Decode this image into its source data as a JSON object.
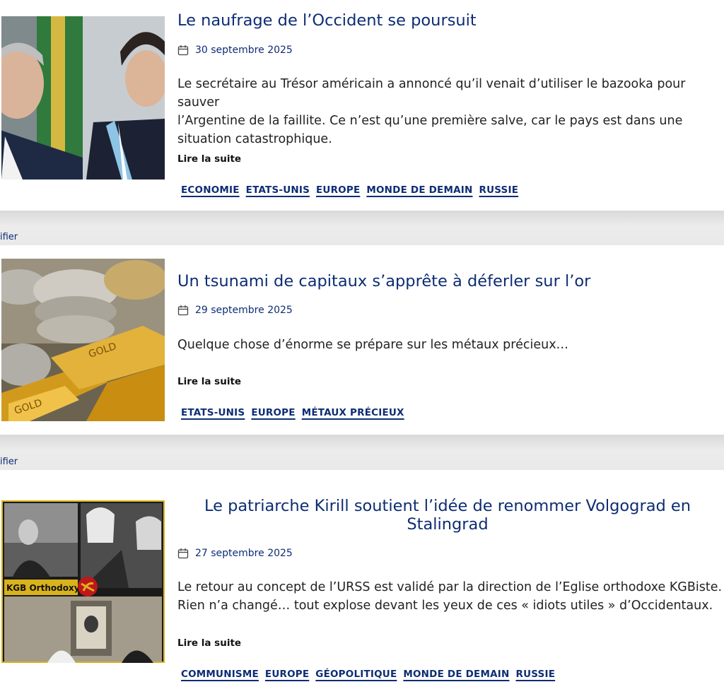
{
  "articles": [
    {
      "title": "Le naufrage de l’Occident se poursuit",
      "date": "30 septembre 2025",
      "excerpt_lines": [
        "Le secrétaire au Trésor américain a annoncé qu’il venait d’utiliser le bazooka pour sauver",
        "l’Argentine de la faillite. Ce n’est qu’une première salve, car le pays est dans une",
        "situation catastrophique."
      ],
      "read_more": "Lire la suite",
      "tags": [
        "ECONOMIE",
        "ETATS-UNIS",
        "EUROPE",
        "MONDE DE DEMAIN",
        "RUSSIE"
      ]
    },
    {
      "title": "Un tsunami de capitaux s’apprête à déferler sur l’or",
      "date": "29 septembre 2025",
      "excerpt_lines": [
        "Quelque chose d’énorme se prépare sur les métaux précieux…"
      ],
      "read_more": "Lire la suite",
      "tags": [
        "ETATS-UNIS",
        "EUROPE",
        "MÉTAUX PRÉCIEUX"
      ]
    },
    {
      "title_lines": [
        "Le patriarche Kirill soutient l’idée de renommer Volgograd en",
        "Stalingrad"
      ],
      "date": "27 septembre 2025",
      "excerpt_lines": [
        "Le retour au concept de l’URSS est validé par la direction de l’Eglise orthodoxe KGBiste.",
        "Rien n’a changé… tout explose devant les yeux de ces « idiots utiles » d’Occidentaux."
      ],
      "read_more": "Lire la suite",
      "tags": [
        "COMMUNISME",
        "EUROPE",
        "GÉOPOLITIQUE",
        "MONDE DE DEMAIN",
        "RUSSIE"
      ],
      "image_text": "KGB Orthodoxy"
    }
  ],
  "separators": [
    {
      "text": "ifier"
    },
    {
      "text": "ifier"
    }
  ],
  "icons": {
    "date": "calendar-icon"
  },
  "colors": {
    "accent": "#0d2d73",
    "separator": "#e6e6e6"
  }
}
